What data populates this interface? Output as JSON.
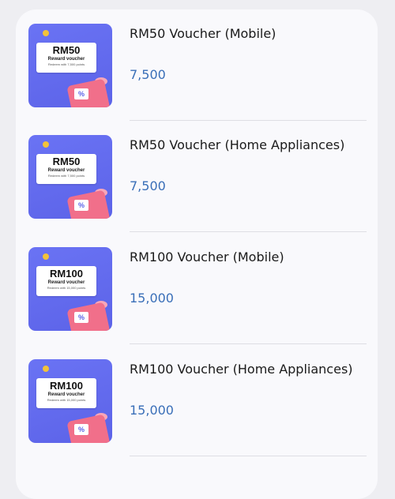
{
  "vouchers": [
    {
      "title": "RM50 Voucher (Mobile)",
      "points": "7,500",
      "thumb_amount": "RM50",
      "thumb_label": "Reward voucher",
      "thumb_redeem": "Redeem with 7,500 points"
    },
    {
      "title": "RM50 Voucher (Home Appliances)",
      "points": "7,500",
      "thumb_amount": "RM50",
      "thumb_label": "Reward voucher",
      "thumb_redeem": "Redeem with 7,500 points"
    },
    {
      "title": "RM100 Voucher (Mobile)",
      "points": "15,000",
      "thumb_amount": "RM100",
      "thumb_label": "Reward voucher",
      "thumb_redeem": "Redeem with 15,000 points"
    },
    {
      "title": "RM100 Voucher (Home Appliances)",
      "points": "15,000",
      "thumb_amount": "RM100",
      "thumb_label": "Reward voucher",
      "thumb_redeem": "Redeem with 15,000 points"
    }
  ],
  "colors": {
    "background": "#eeeef2",
    "card": "#f9f9fc",
    "thumbnail": "#6a73f4",
    "points_text": "#3a6fb8",
    "title_text": "#1a1a1a"
  },
  "icons": {
    "coin": "coin-icon",
    "gift": "gift-box-icon",
    "percent": "percent-tag-icon"
  }
}
